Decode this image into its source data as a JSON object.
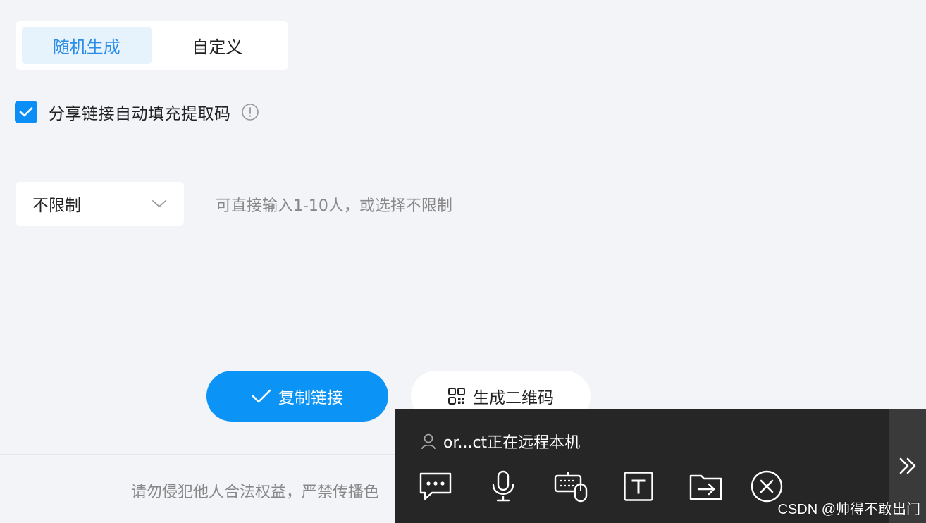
{
  "tabs": [
    {
      "label": "随机生成",
      "active": true
    },
    {
      "label": "自定义",
      "active": false
    }
  ],
  "auto_fill": {
    "label": "分享链接自动填充提取码",
    "checked": true
  },
  "limit": {
    "value": "不限制",
    "hint": "可直接输入1-10人，或选择不限制"
  },
  "buttons": {
    "copy_link": "复制链接",
    "qr_code": "生成二维码"
  },
  "footer": {
    "note": "请勿侵犯他人合法权益，严禁传播色"
  },
  "remote": {
    "status": "or...ct正在远程本机",
    "tools": [
      "chat-icon",
      "microphone-icon",
      "keyboard-mouse-icon",
      "text-icon",
      "file-transfer-icon",
      "disconnect-icon"
    ],
    "expand_icon": "double-chevron-right-icon"
  },
  "watermark": "CSDN @帅得不敢出门",
  "colors": {
    "accent": "#0b93f6",
    "tab_active_bg": "#e6f3fd",
    "toolbar_bg": "#262626"
  }
}
